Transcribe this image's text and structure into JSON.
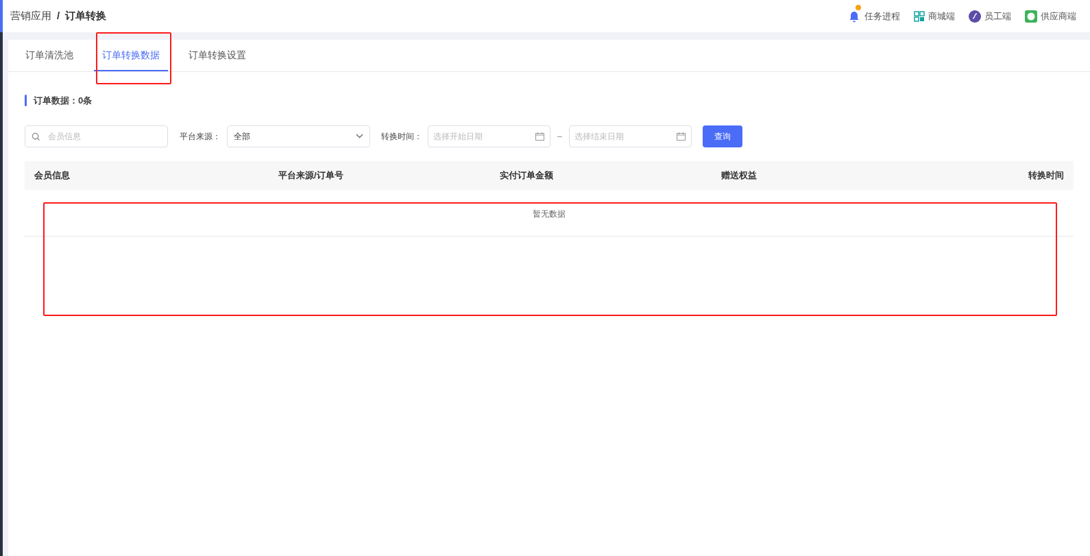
{
  "breadcrumb": [
    {
      "label": "营销应用"
    },
    {
      "label": "订单转换"
    }
  ],
  "breadcrumb_separator": "/",
  "header_links": [
    {
      "kind": "bell",
      "label": "任务进程",
      "badge": true
    },
    {
      "kind": "qr",
      "label": "商城端",
      "badge": false
    },
    {
      "kind": "staff",
      "label": "员工端",
      "badge": false
    },
    {
      "kind": "supplier",
      "label": "供应商端",
      "badge": false
    }
  ],
  "tabs": [
    {
      "label": "订单清洗池",
      "selected": false
    },
    {
      "label": "订单转换数据",
      "selected": true
    },
    {
      "label": "订单转换设置",
      "selected": false
    }
  ],
  "section_title": "订单数据：0条",
  "filters": {
    "member_search": {
      "placeholder": "会员信息"
    },
    "platform_label": "平台来源：",
    "platform_value": "全部",
    "time_label": "转换时间：",
    "start_date": {
      "placeholder": "选择开始日期"
    },
    "date_separator": "–",
    "end_date": {
      "placeholder": "选择结束日期"
    },
    "query_button": "查询"
  },
  "table": {
    "columns": [
      "会员信息",
      "平台来源/订单号",
      "实付订单金额",
      "赠送权益",
      "转换时间"
    ],
    "empty_text": "暂无数据"
  }
}
